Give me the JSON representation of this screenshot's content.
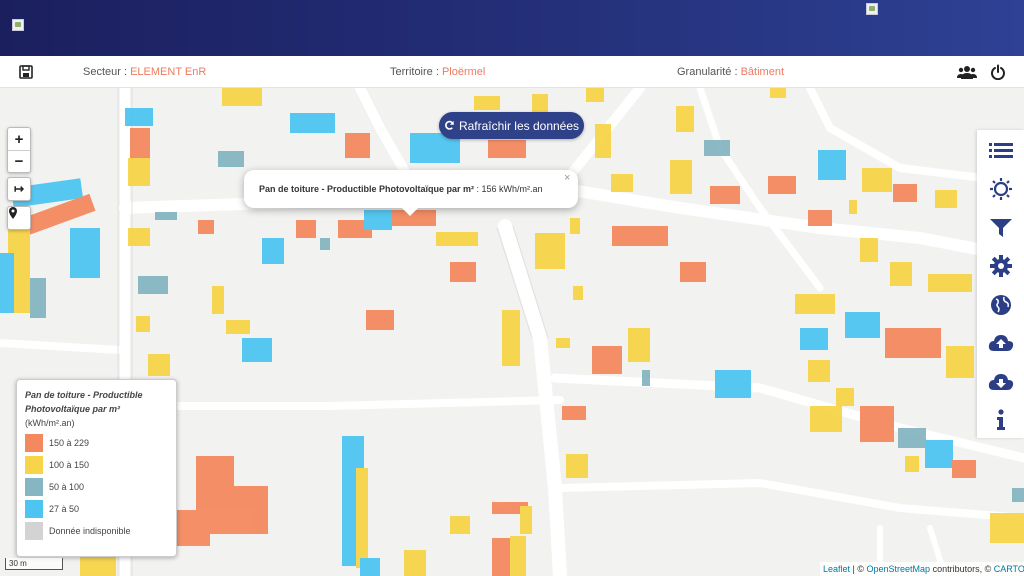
{
  "header": {
    "logo_left_alt": "",
    "logo_right_alt": ""
  },
  "toolbar": {
    "save_icon": "save-icon",
    "secteur_label": "Secteur : ",
    "secteur_value": "ELEMENT EnR",
    "territoire_label": "Territoire : ",
    "territoire_value": "Ploërmel",
    "granularite_label": "Granularité : ",
    "granularite_value": "Bâtiment",
    "users_icon": "users-icon",
    "power_icon": "power-icon"
  },
  "map_controls": {
    "zoom_in": "+",
    "zoom_out": "−",
    "measure": "↦",
    "locate": "location-pin-icon"
  },
  "refresh_button": {
    "label": "Rafraîchir les données",
    "icon": "refresh-icon"
  },
  "popup": {
    "title": "Pan de toiture - Productible Photovoltaïque par m²",
    "value": " : 156 kWh/m².an",
    "close": "×"
  },
  "legend": {
    "title_line1": "Pan de toiture - Productible",
    "title_line2": "Photovoltaïque par m²",
    "unit": "(kWh/m².an)",
    "items": [
      {
        "label": "150 à 229",
        "color": "#f4895f"
      },
      {
        "label": "100 à 150",
        "color": "#f7d449"
      },
      {
        "label": "50 à 100",
        "color": "#86b6c1"
      },
      {
        "label": "27 à 50",
        "color": "#4ec5f0"
      },
      {
        "label": "Donnée indisponible",
        "color": "#d3d3d3"
      }
    ]
  },
  "scale": {
    "label": "30 m"
  },
  "attribution": {
    "leaflet": "Leaflet",
    "sep1": " | © ",
    "osm": "OpenStreetMap",
    "contributors": " contributors, © ",
    "carto": "CARTO"
  },
  "right_panel": {
    "buttons": [
      "layers-list-icon",
      "sun-icon",
      "filter-icon",
      "settings-icon",
      "globe-icon",
      "upload-icon",
      "download-icon",
      "info-icon"
    ]
  },
  "colors": {
    "header_bg": "#24307a",
    "accent": "#ef7a5f",
    "button": "#2f4189"
  }
}
